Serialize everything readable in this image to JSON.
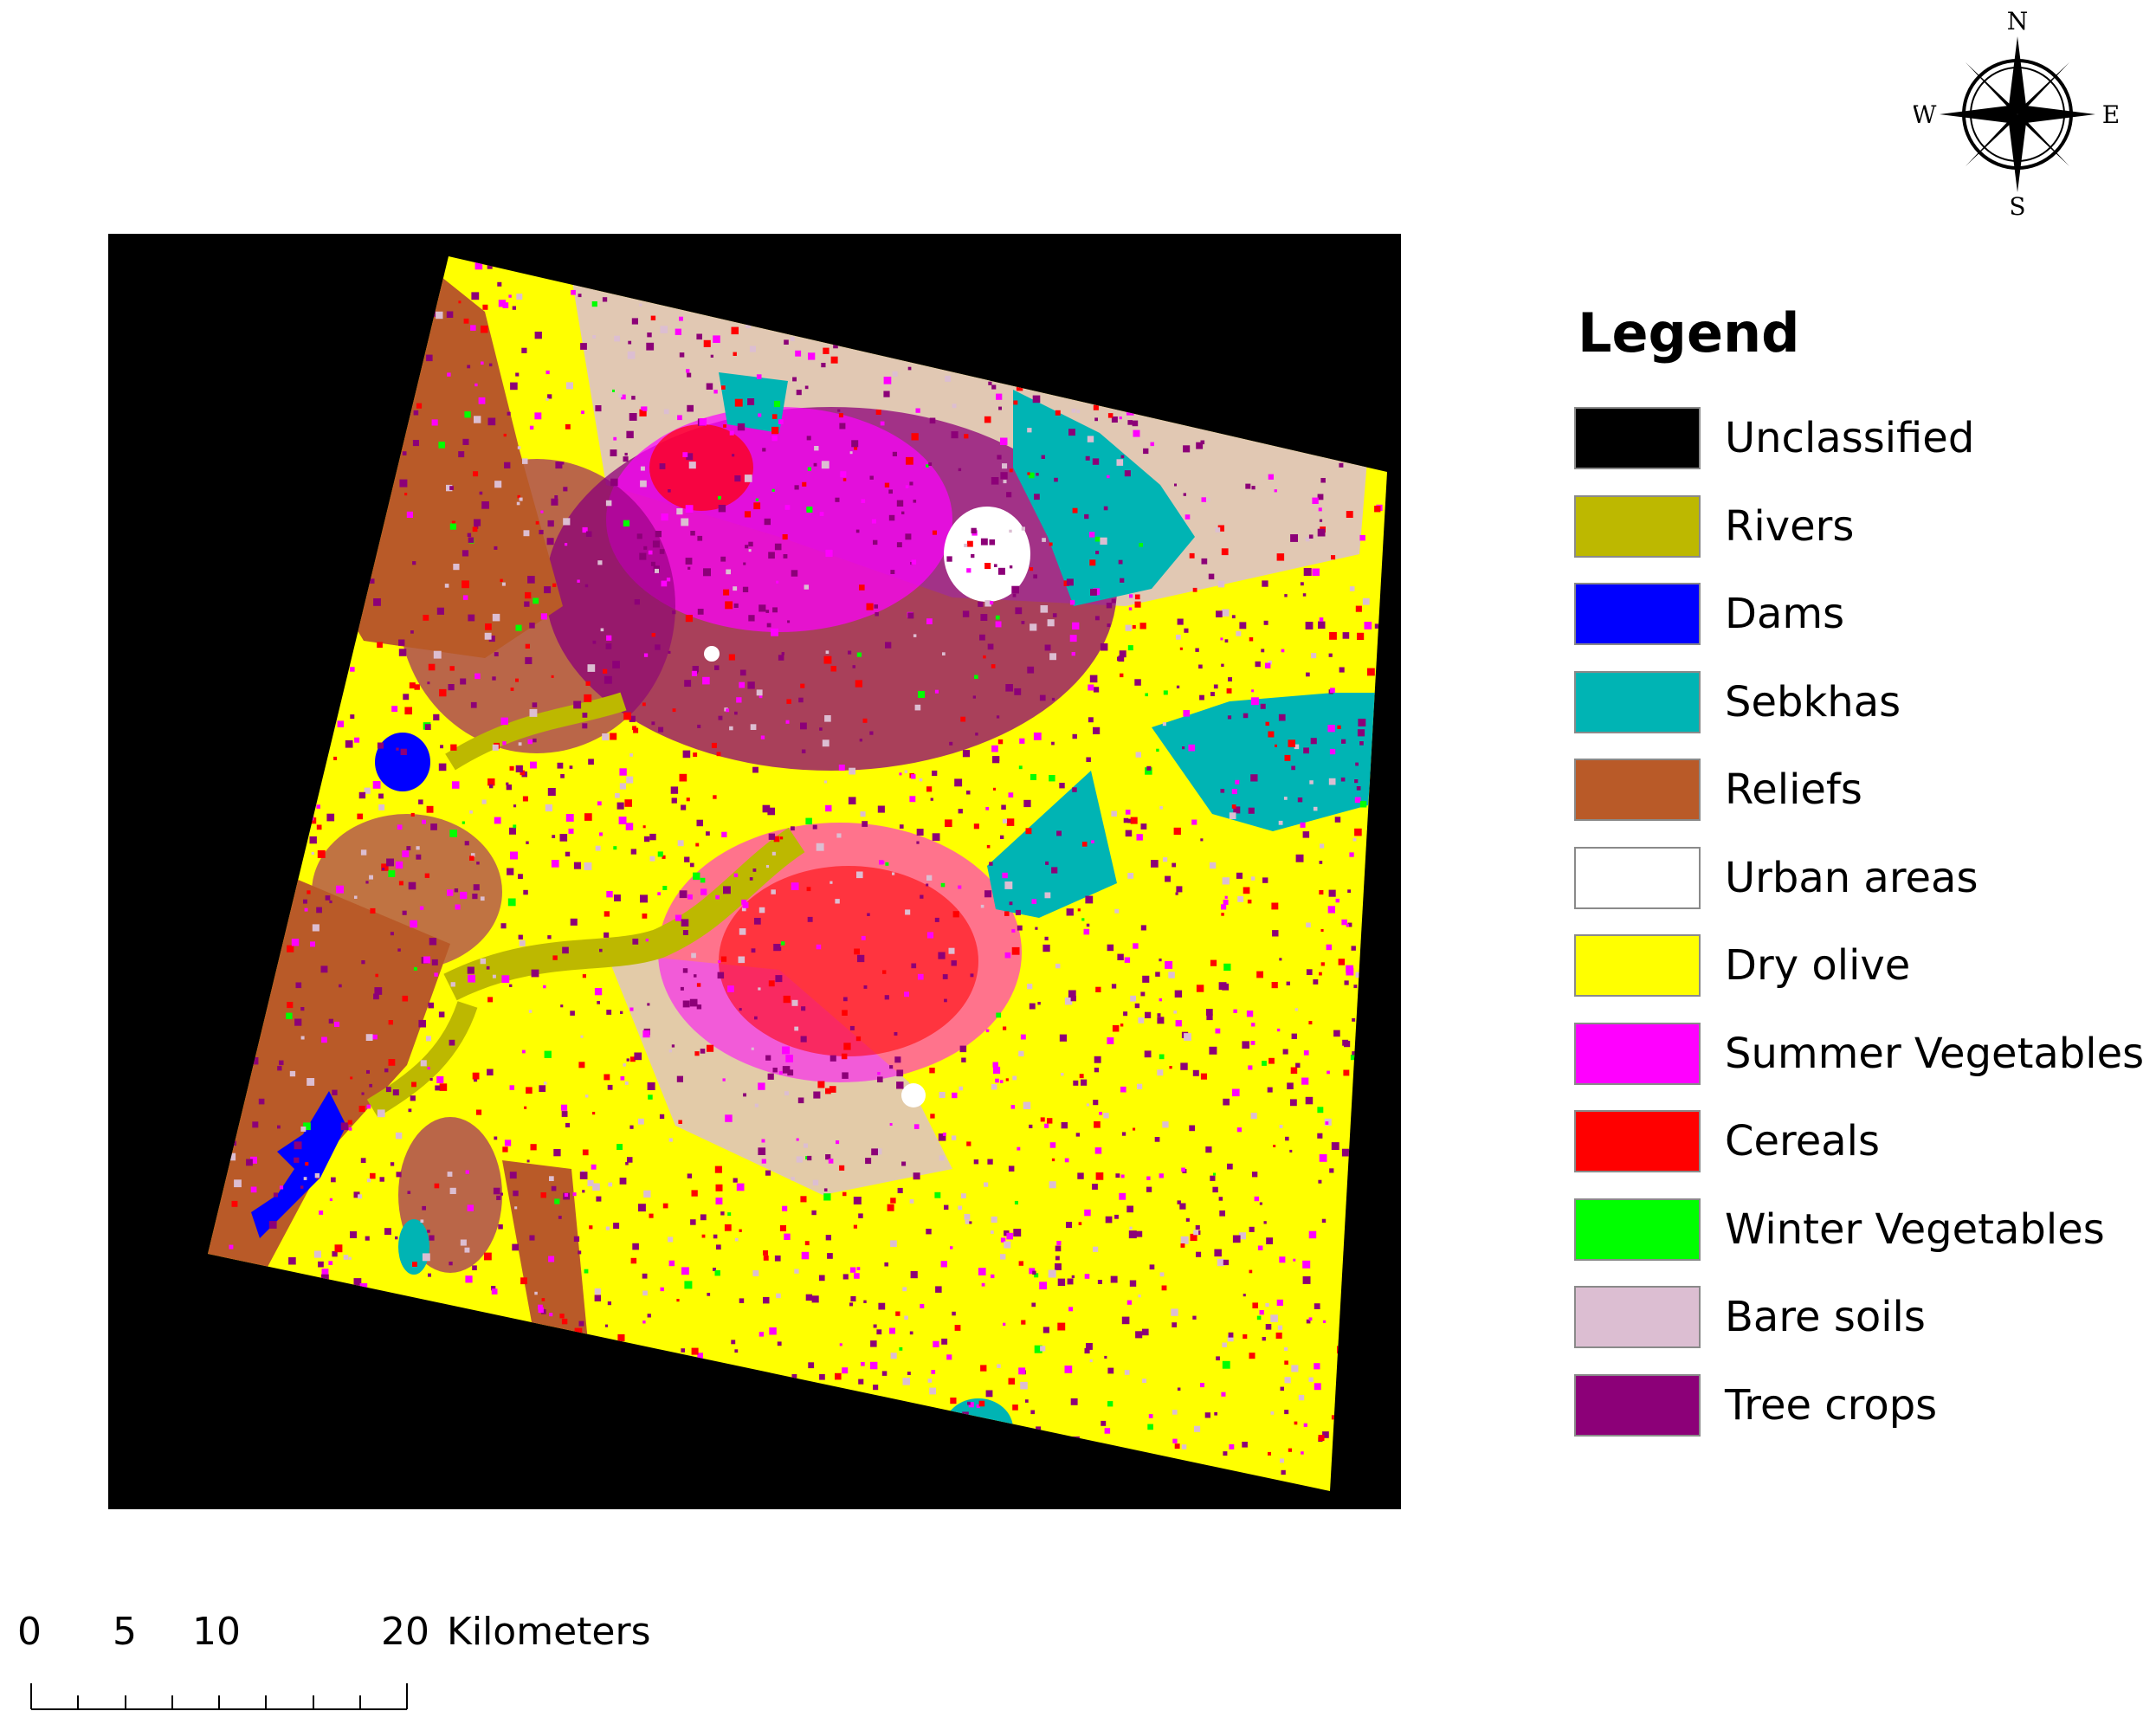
{
  "map": {
    "background": "#000000",
    "colors": {
      "unclassified": "#000000",
      "rivers": "#bdb800",
      "dams": "#0000ff",
      "sebkhas": "#00b4b4",
      "reliefs": "#b95a28",
      "urban": "#ffffff",
      "dry_olive": "#ffff00",
      "summer_veg": "#ff00ff",
      "cereals": "#ff0000",
      "winter_veg": "#00ff00",
      "bare_soils": "#dcbed2",
      "tree_crops": "#8c0078"
    }
  },
  "legend": {
    "title": "Legend",
    "items": [
      {
        "label": "Unclassified",
        "color": "#000000"
      },
      {
        "label": "Rivers",
        "color": "#bdb800"
      },
      {
        "label": "Dams",
        "color": "#0000ff"
      },
      {
        "label": "Sebkhas",
        "color": "#00b4b4"
      },
      {
        "label": "Reliefs",
        "color": "#b95a28"
      },
      {
        "label": "Urban areas",
        "color": "#ffffff"
      },
      {
        "label": "Dry olive",
        "color": "#ffff00"
      },
      {
        "label": "Summer Vegetables",
        "color": "#ff00ff"
      },
      {
        "label": "Cereals",
        "color": "#ff0000"
      },
      {
        "label": "Winter Vegetables",
        "color": "#00ff00"
      },
      {
        "label": "Bare soils",
        "color": "#dcbed2"
      },
      {
        "label": "Tree crops",
        "color": "#8c0078"
      }
    ]
  },
  "scale_bar": {
    "ticks": [
      "0",
      "5",
      "10",
      "20"
    ],
    "unit": "Kilometers"
  },
  "compass": {
    "north": "N",
    "south": "S",
    "east": "E",
    "west": "W"
  }
}
